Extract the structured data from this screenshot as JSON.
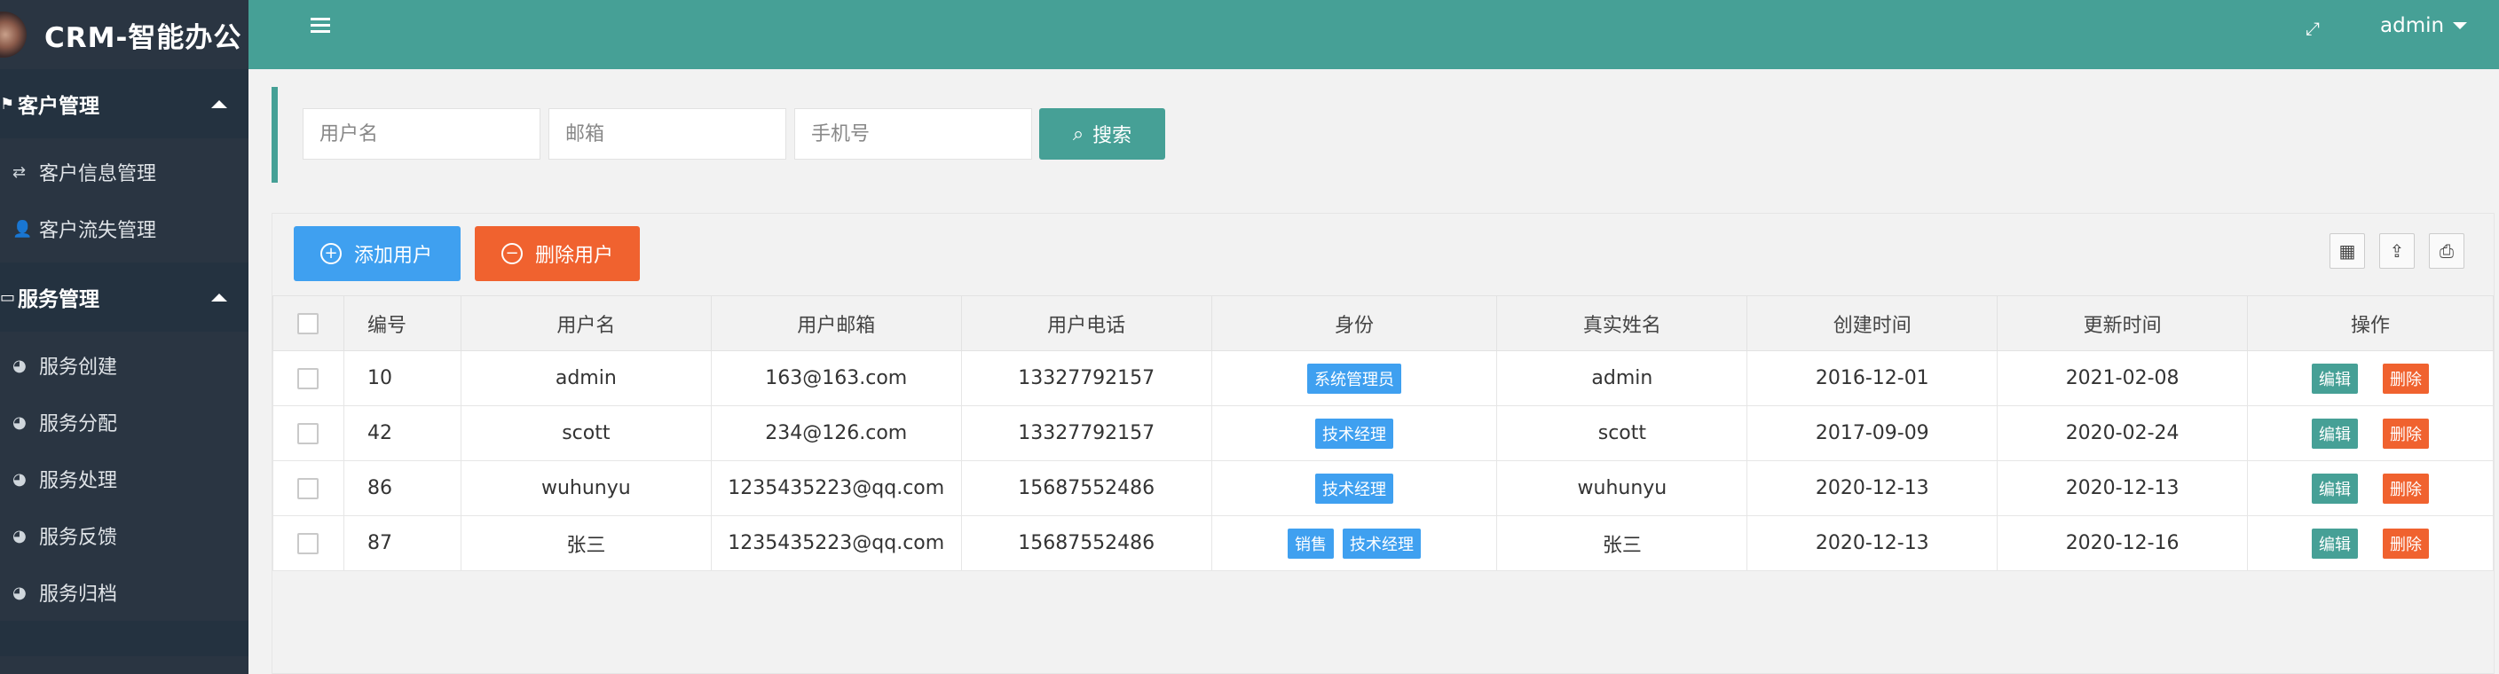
{
  "app": {
    "title": "CRM-智能办公"
  },
  "sidebar": {
    "groups": [
      {
        "label": "客户管理",
        "items": [
          {
            "label": "客户信息管理"
          },
          {
            "label": "客户流失管理"
          }
        ]
      },
      {
        "label": "服务管理",
        "items": [
          {
            "label": "服务创建"
          },
          {
            "label": "服务分配"
          },
          {
            "label": "服务处理"
          },
          {
            "label": "服务反馈"
          },
          {
            "label": "服务归档"
          }
        ]
      }
    ]
  },
  "header": {
    "user": "admin"
  },
  "search": {
    "username_placeholder": "用户名",
    "email_placeholder": "邮箱",
    "phone_placeholder": "手机号",
    "button_label": "搜索"
  },
  "toolbar": {
    "add_label": "添加用户",
    "delete_label": "删除用户"
  },
  "table": {
    "headers": [
      "编号",
      "用户名",
      "用户邮箱",
      "用户电话",
      "身份",
      "真实姓名",
      "创建时间",
      "更新时间",
      "操作"
    ],
    "edit_label": "编辑",
    "delete_label": "删除",
    "rows": [
      {
        "id": "10",
        "username": "admin",
        "email": "163@163.com",
        "phone": "13327792157",
        "roles": [
          "系统管理员"
        ],
        "true_name": "admin",
        "created": "2016-12-01",
        "updated": "2021-02-08"
      },
      {
        "id": "42",
        "username": "scott",
        "email": "234@126.com",
        "phone": "13327792157",
        "roles": [
          "技术经理"
        ],
        "true_name": "scott",
        "created": "2017-09-09",
        "updated": "2020-02-24"
      },
      {
        "id": "86",
        "username": "wuhunyu",
        "email": "1235435223@qq.com",
        "phone": "15687552486",
        "roles": [
          "技术经理"
        ],
        "true_name": "wuhunyu",
        "created": "2020-12-13",
        "updated": "2020-12-13"
      },
      {
        "id": "87",
        "username": "张三",
        "email": "1235435223@qq.com",
        "phone": "15687552486",
        "roles": [
          "销售",
          "技术经理"
        ],
        "true_name": "张三",
        "created": "2020-12-13",
        "updated": "2020-12-16"
      }
    ]
  },
  "colors": {
    "primary": "#46a096",
    "sidebar": "#2a3542",
    "blue": "#3fa0f0",
    "orange": "#f0622f"
  }
}
